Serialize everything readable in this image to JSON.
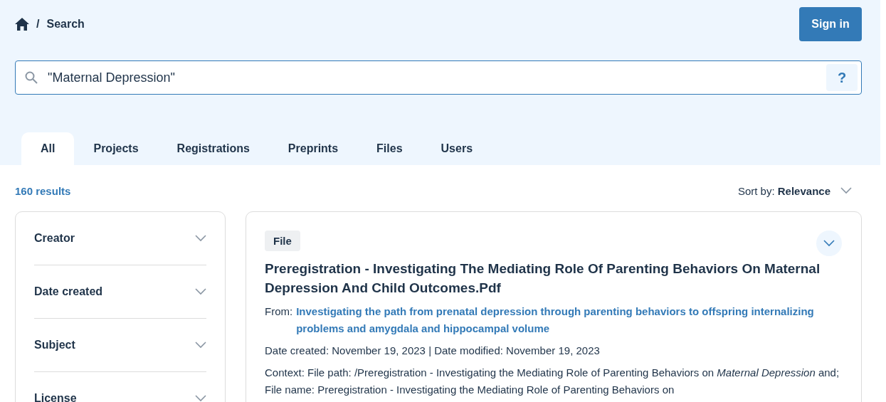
{
  "breadcrumb": {
    "separator": "/",
    "current": "Search"
  },
  "sign_in_button": "Sign in",
  "search": {
    "value": "\"Maternal Depression\"",
    "help": "?"
  },
  "tabs": [
    {
      "label": "All",
      "selected": true
    },
    {
      "label": "Projects",
      "selected": false
    },
    {
      "label": "Registrations",
      "selected": false
    },
    {
      "label": "Preprints",
      "selected": false
    },
    {
      "label": "Files",
      "selected": false
    },
    {
      "label": "Users",
      "selected": false
    }
  ],
  "result_count": "160 results",
  "sort": "Sort by: **Relevance**",
  "filters": [
    {
      "label": "Creator",
      "expanded": false
    },
    {
      "label": "Date created",
      "expanded": false
    },
    {
      "label": "Subject",
      "expanded": false
    },
    {
      "label": "License",
      "expanded": false
    }
  ],
  "results": [
    {
      "type": "File",
      "expanded": false,
      "title": "Preregistration - Investigating The Mediating Role Of Parenting Behaviors On Maternal Depression And Child Outcomes.Pdf",
      "from_label": "From:",
      "from_link": "Investigating the path from prenatal depression through parenting behaviors to offspring internalizing problems and amygdala and hippocampal volume",
      "dates": "Date created: November 19, 2023 | Date modified: November 19, 2023",
      "context": "Context: File path: /Preregistration - Investigating the Mediating Role of Parenting Behaviors on *Maternal Depression* and; File name: Preregistration - Investigating the Mediating Role of Parenting Behaviors on"
    }
  ]
}
